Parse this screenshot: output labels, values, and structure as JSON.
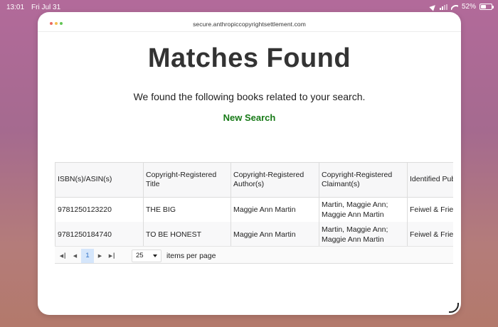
{
  "status_bar": {
    "time": "13:01",
    "date": "Fri Jul 31",
    "battery": "52%",
    "battery_level": 0.52
  },
  "browser": {
    "url": "secure.anthropiccopyrightsettlement.com",
    "dot_colors": [
      "#ea6b5f",
      "#f3be4f",
      "#62c554"
    ]
  },
  "page": {
    "title": "Matches Found",
    "subtitle": "We found the following books related to your search.",
    "new_search_label": "New Search"
  },
  "table": {
    "columns": [
      "ISBN(s)/ASIN(s)",
      "Copyright-Registered Title",
      "Copyright-Registered Author(s)",
      "Copyright-Registered Claimant(s)",
      "Identified Publisher(s)"
    ],
    "rows": [
      [
        "9781250123220",
        "THE BIG",
        "Maggie Ann Martin",
        "Martin, Maggie Ann; Maggie Ann Martin",
        "Feiwel & Friends"
      ],
      [
        "9781250184740",
        "TO BE HONEST",
        "Maggie Ann Martin",
        "Martin, Maggie Ann; Maggie Ann Martin",
        "Feiwel & Friends"
      ]
    ]
  },
  "pager": {
    "first_icon": "first-page-icon",
    "prev_icon": "prev-page-icon",
    "next_icon": "next-page-icon",
    "last_icon": "last-page-icon",
    "current_page": "1",
    "page_size": "25",
    "items_per_page_label": "items per page"
  },
  "colors": {
    "link_green": "#177a17",
    "selected_page_bg": "#d5e6fb"
  }
}
